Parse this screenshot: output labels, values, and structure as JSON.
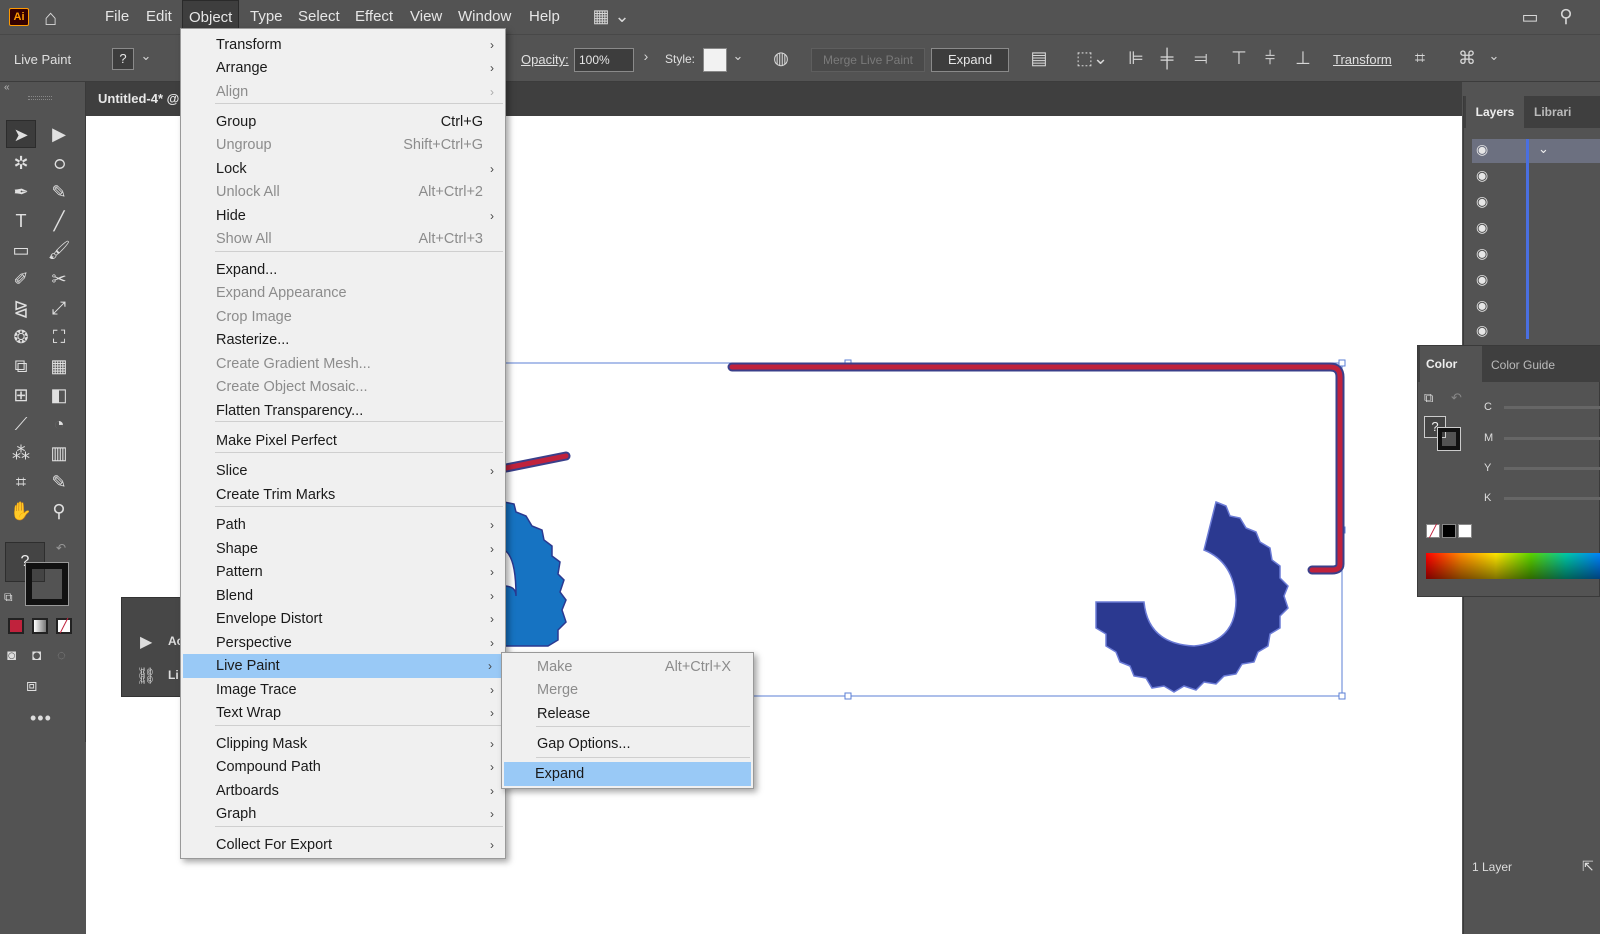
{
  "app": {
    "logo": "Ai"
  },
  "menubar": {
    "items": [
      "File",
      "Edit",
      "Object",
      "Type",
      "Select",
      "Effect",
      "View",
      "Window",
      "Help"
    ]
  },
  "controlbar": {
    "mode_label": "Live Paint",
    "stroke_q": "?",
    "opacity_label": "Opacity:",
    "opacity_value": "100%",
    "style_label": "Style:",
    "merge_label": "Merge Live Paint",
    "expand_label": "Expand",
    "transform_label": "Transform"
  },
  "document": {
    "tab_title": "Untitled-4* @"
  },
  "toolbar": {
    "fill_q": "?"
  },
  "actions_panel": {
    "row1": "Ac",
    "row2": "Li"
  },
  "object_menu": {
    "items": [
      {
        "label": "Transform",
        "shortcut": "",
        "submenu": true,
        "disabled": false
      },
      {
        "label": "Arrange",
        "shortcut": "",
        "submenu": true,
        "disabled": false
      },
      {
        "label": "Align",
        "shortcut": "",
        "submenu": true,
        "disabled": true
      },
      {
        "label": "Group",
        "shortcut": "Ctrl+G",
        "submenu": false,
        "disabled": false
      },
      {
        "label": "Ungroup",
        "shortcut": "Shift+Ctrl+G",
        "submenu": false,
        "disabled": true
      },
      {
        "label": "Lock",
        "shortcut": "",
        "submenu": true,
        "disabled": false
      },
      {
        "label": "Unlock All",
        "shortcut": "Alt+Ctrl+2",
        "submenu": false,
        "disabled": true
      },
      {
        "label": "Hide",
        "shortcut": "",
        "submenu": true,
        "disabled": false
      },
      {
        "label": "Show All",
        "shortcut": "Alt+Ctrl+3",
        "submenu": false,
        "disabled": true
      },
      {
        "label": "Expand...",
        "shortcut": "",
        "submenu": false,
        "disabled": false
      },
      {
        "label": "Expand Appearance",
        "shortcut": "",
        "submenu": false,
        "disabled": true
      },
      {
        "label": "Crop Image",
        "shortcut": "",
        "submenu": false,
        "disabled": true
      },
      {
        "label": "Rasterize...",
        "shortcut": "",
        "submenu": false,
        "disabled": false
      },
      {
        "label": "Create Gradient Mesh...",
        "shortcut": "",
        "submenu": false,
        "disabled": true
      },
      {
        "label": "Create Object Mosaic...",
        "shortcut": "",
        "submenu": false,
        "disabled": true
      },
      {
        "label": "Flatten Transparency...",
        "shortcut": "",
        "submenu": false,
        "disabled": false
      },
      {
        "label": "Make Pixel Perfect",
        "shortcut": "",
        "submenu": false,
        "disabled": false
      },
      {
        "label": "Slice",
        "shortcut": "",
        "submenu": true,
        "disabled": false
      },
      {
        "label": "Create Trim Marks",
        "shortcut": "",
        "submenu": false,
        "disabled": false
      },
      {
        "label": "Path",
        "shortcut": "",
        "submenu": true,
        "disabled": false
      },
      {
        "label": "Shape",
        "shortcut": "",
        "submenu": true,
        "disabled": false
      },
      {
        "label": "Pattern",
        "shortcut": "",
        "submenu": true,
        "disabled": false
      },
      {
        "label": "Blend",
        "shortcut": "",
        "submenu": true,
        "disabled": false
      },
      {
        "label": "Envelope Distort",
        "shortcut": "",
        "submenu": true,
        "disabled": false
      },
      {
        "label": "Perspective",
        "shortcut": "",
        "submenu": true,
        "disabled": false
      },
      {
        "label": "Live Paint",
        "shortcut": "",
        "submenu": true,
        "disabled": false,
        "highlighted": true
      },
      {
        "label": "Image Trace",
        "shortcut": "",
        "submenu": true,
        "disabled": false
      },
      {
        "label": "Text Wrap",
        "shortcut": "",
        "submenu": true,
        "disabled": false
      },
      {
        "label": "Clipping Mask",
        "shortcut": "",
        "submenu": true,
        "disabled": false
      },
      {
        "label": "Compound Path",
        "shortcut": "",
        "submenu": true,
        "disabled": false
      },
      {
        "label": "Artboards",
        "shortcut": "",
        "submenu": true,
        "disabled": false
      },
      {
        "label": "Graph",
        "shortcut": "",
        "submenu": true,
        "disabled": false
      },
      {
        "label": "Collect For Export",
        "shortcut": "",
        "submenu": true,
        "disabled": false
      }
    ]
  },
  "livepaint_submenu": {
    "items": [
      {
        "label": "Make",
        "shortcut": "Alt+Ctrl+X",
        "disabled": true
      },
      {
        "label": "Merge",
        "shortcut": "",
        "disabled": true
      },
      {
        "label": "Release",
        "shortcut": "",
        "disabled": false
      },
      {
        "label": "Gap Options...",
        "shortcut": "",
        "disabled": false
      },
      {
        "label": "Expand",
        "shortcut": "",
        "disabled": false,
        "highlighted": true
      }
    ]
  },
  "layers_panel": {
    "tab_layers": "Layers",
    "tab_libraries": "Librari",
    "footer": "1 Layer"
  },
  "color_panel": {
    "tab_color": "Color",
    "tab_guide": "Color Guide",
    "channels": [
      "C",
      "M",
      "Y",
      "K"
    ],
    "q": "?"
  },
  "colors": {
    "accent_red": "#c0223c",
    "gear_left": "#1673c2",
    "gear_right": "#2b3990",
    "menu_highlight": "#99c9f6"
  }
}
